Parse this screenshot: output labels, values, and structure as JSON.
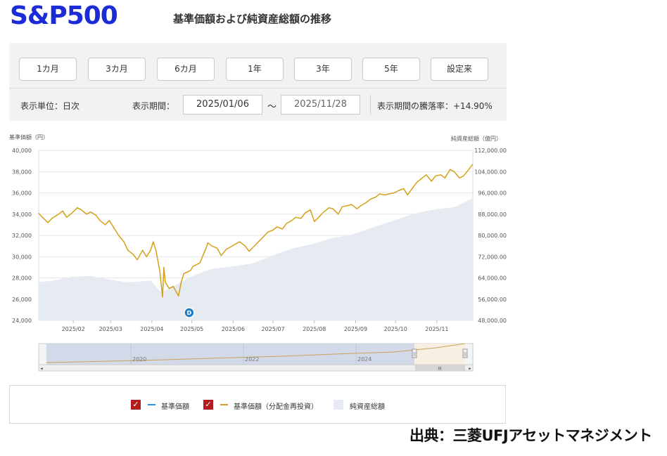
{
  "brand": "S&P500",
  "title": "基準価額および純資産総額の推移",
  "range_buttons": [
    "1カ月",
    "3カ月",
    "6カ月",
    "1年",
    "3年",
    "5年",
    "設定来"
  ],
  "controls": {
    "unit": "表示単位：日次",
    "period_label": "表示期間：",
    "date_from": "2025/01/06",
    "tilde": "〜",
    "date_to": "2025/11/28",
    "change": "表示期間の騰落率：+14.90%"
  },
  "chart_data": {
    "type": "line",
    "left_axis_label": "基準価額（円）",
    "right_axis_label": "純資産総額（億円）",
    "left_ylim": [
      24000,
      40000
    ],
    "right_ylim": [
      48000,
      112000
    ],
    "left_ticks": [
      "40,000",
      "38,000",
      "36,000",
      "34,000",
      "32,000",
      "30,000",
      "28,000",
      "26,000",
      "24,000"
    ],
    "right_ticks": [
      "112,000.00",
      "104,000.00",
      "96,000.00",
      "88,000.00",
      "80,000.00",
      "72,000.00",
      "64,000.00",
      "56,000.00",
      "48,000.00"
    ],
    "x_range": [
      "2025-01-06",
      "2025-11-28"
    ],
    "x_ticks": [
      {
        "date": "2025-02-01",
        "label": "2025/02"
      },
      {
        "date": "2025-03-01",
        "label": "2025/03"
      },
      {
        "date": "2025-04-01",
        "label": "2025/04"
      },
      {
        "date": "2025-05-01",
        "label": "2025/05"
      },
      {
        "date": "2025-06-01",
        "label": "2025/06"
      },
      {
        "date": "2025-07-01",
        "label": "2025/07"
      },
      {
        "date": "2025-08-01",
        "label": "2025/08"
      },
      {
        "date": "2025-09-01",
        "label": "2025/09"
      },
      {
        "date": "2025-10-01",
        "label": "2025/10"
      },
      {
        "date": "2025-11-01",
        "label": "2025/11"
      }
    ],
    "grid": true,
    "series": [
      {
        "name": "基準価額（分配金再投資）",
        "color": "#d4a017",
        "axis": "left",
        "points": [
          [
            "2025-01-06",
            34100
          ],
          [
            "2025-01-08",
            33800
          ],
          [
            "2025-01-13",
            33200
          ],
          [
            "2025-01-16",
            33600
          ],
          [
            "2025-01-21",
            34000
          ],
          [
            "2025-01-24",
            34300
          ],
          [
            "2025-01-27",
            33700
          ],
          [
            "2025-01-31",
            34100
          ],
          [
            "2025-02-04",
            34600
          ],
          [
            "2025-02-07",
            34400
          ],
          [
            "2025-02-11",
            34000
          ],
          [
            "2025-02-14",
            34200
          ],
          [
            "2025-02-18",
            33900
          ],
          [
            "2025-02-21",
            33400
          ],
          [
            "2025-02-25",
            33000
          ],
          [
            "2025-02-28",
            33400
          ],
          [
            "2025-03-04",
            32600
          ],
          [
            "2025-03-07",
            32000
          ],
          [
            "2025-03-11",
            31400
          ],
          [
            "2025-03-14",
            30600
          ],
          [
            "2025-03-18",
            30200
          ],
          [
            "2025-03-21",
            29700
          ],
          [
            "2025-03-25",
            30600
          ],
          [
            "2025-03-28",
            30000
          ],
          [
            "2025-03-31",
            30600
          ],
          [
            "2025-04-02",
            31400
          ],
          [
            "2025-04-04",
            30600
          ],
          [
            "2025-04-07",
            28600
          ],
          [
            "2025-04-09",
            26200
          ],
          [
            "2025-04-10",
            29000
          ],
          [
            "2025-04-11",
            27600
          ],
          [
            "2025-04-14",
            27000
          ],
          [
            "2025-04-17",
            27200
          ],
          [
            "2025-04-21",
            26300
          ],
          [
            "2025-04-23",
            27600
          ],
          [
            "2025-04-25",
            28400
          ],
          [
            "2025-04-30",
            28700
          ],
          [
            "2025-05-02",
            29100
          ],
          [
            "2025-05-07",
            29400
          ],
          [
            "2025-05-12",
            30900
          ],
          [
            "2025-05-13",
            31300
          ],
          [
            "2025-05-16",
            31000
          ],
          [
            "2025-05-20",
            30800
          ],
          [
            "2025-05-23",
            30100
          ],
          [
            "2025-05-27",
            30700
          ],
          [
            "2025-05-30",
            30900
          ],
          [
            "2025-06-03",
            31200
          ],
          [
            "2025-06-06",
            31400
          ],
          [
            "2025-06-10",
            31000
          ],
          [
            "2025-06-13",
            30500
          ],
          [
            "2025-06-17",
            31000
          ],
          [
            "2025-06-20",
            31400
          ],
          [
            "2025-06-24",
            31900
          ],
          [
            "2025-06-27",
            32300
          ],
          [
            "2025-07-01",
            32500
          ],
          [
            "2025-07-04",
            32800
          ],
          [
            "2025-07-08",
            32600
          ],
          [
            "2025-07-11",
            33100
          ],
          [
            "2025-07-15",
            33400
          ],
          [
            "2025-07-18",
            33700
          ],
          [
            "2025-07-22",
            33600
          ],
          [
            "2025-07-25",
            34100
          ],
          [
            "2025-07-29",
            34400
          ],
          [
            "2025-08-01",
            33300
          ],
          [
            "2025-08-05",
            33800
          ],
          [
            "2025-08-08",
            34200
          ],
          [
            "2025-08-12",
            34600
          ],
          [
            "2025-08-15",
            34500
          ],
          [
            "2025-08-19",
            34000
          ],
          [
            "2025-08-22",
            34700
          ],
          [
            "2025-08-26",
            34800
          ],
          [
            "2025-08-29",
            34900
          ],
          [
            "2025-09-02",
            34500
          ],
          [
            "2025-09-05",
            34800
          ],
          [
            "2025-09-09",
            35100
          ],
          [
            "2025-09-12",
            35400
          ],
          [
            "2025-09-16",
            35600
          ],
          [
            "2025-09-19",
            35900
          ],
          [
            "2025-09-23",
            35800
          ],
          [
            "2025-09-26",
            35900
          ],
          [
            "2025-09-30",
            36000
          ],
          [
            "2025-10-03",
            36200
          ],
          [
            "2025-10-07",
            36400
          ],
          [
            "2025-10-10",
            35800
          ],
          [
            "2025-10-14",
            36500
          ],
          [
            "2025-10-17",
            37000
          ],
          [
            "2025-10-21",
            37400
          ],
          [
            "2025-10-24",
            37700
          ],
          [
            "2025-10-28",
            37100
          ],
          [
            "2025-10-31",
            37600
          ],
          [
            "2025-11-04",
            37700
          ],
          [
            "2025-11-07",
            37400
          ],
          [
            "2025-11-11",
            38200
          ],
          [
            "2025-11-14",
            38000
          ],
          [
            "2025-11-18",
            37400
          ],
          [
            "2025-11-21",
            37600
          ],
          [
            "2025-11-25",
            38200
          ],
          [
            "2025-11-28",
            38700
          ]
        ]
      },
      {
        "name": "純資産総額",
        "color": "#e6eaf1",
        "axis": "right",
        "points": [
          [
            "2025-01-06",
            62500
          ],
          [
            "2025-01-15",
            62800
          ],
          [
            "2025-01-31",
            64400
          ],
          [
            "2025-02-14",
            64700
          ],
          [
            "2025-02-28",
            63400
          ],
          [
            "2025-03-14",
            62300
          ],
          [
            "2025-03-31",
            63000
          ],
          [
            "2025-04-08",
            58500
          ],
          [
            "2025-04-15",
            60200
          ],
          [
            "2025-04-30",
            64400
          ],
          [
            "2025-05-15",
            67300
          ],
          [
            "2025-05-30",
            68200
          ],
          [
            "2025-06-16",
            69500
          ],
          [
            "2025-06-30",
            72300
          ],
          [
            "2025-07-15",
            75000
          ],
          [
            "2025-07-31",
            76800
          ],
          [
            "2025-08-15",
            79000
          ],
          [
            "2025-08-29",
            80200
          ],
          [
            "2025-09-15",
            83200
          ],
          [
            "2025-09-30",
            85600
          ],
          [
            "2025-10-15",
            88200
          ],
          [
            "2025-10-31",
            89800
          ],
          [
            "2025-11-14",
            90600
          ],
          [
            "2025-11-28",
            94000
          ]
        ]
      }
    ],
    "marker": {
      "label": "D",
      "date": "2025-04-29"
    }
  },
  "navigator": {
    "year_labels": [
      "2020",
      "2022",
      "2024"
    ],
    "scroll_grip": "III",
    "scroll_left": "◂",
    "scroll_right": "▸",
    "handle_grip": "||"
  },
  "legend": [
    {
      "label": "基準価額",
      "color": "#2f8fd8",
      "checked": true
    },
    {
      "label": "基準価額（分配金再投資）",
      "color": "#d4a017",
      "checked": true
    },
    {
      "label": "純資産総額",
      "color": "#e6eaf1"
    }
  ],
  "legend_check": "✓",
  "source": "出典：三菱UFJアセットマネジメント"
}
